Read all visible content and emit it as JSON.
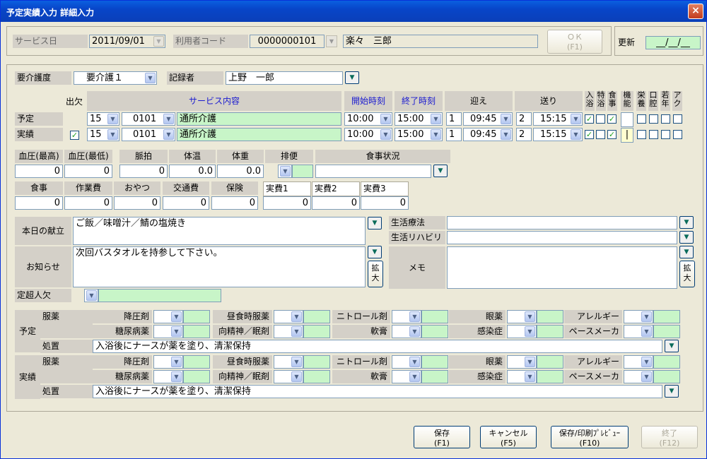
{
  "window": {
    "title": "予定実績入力 詳細入力",
    "close": "×"
  },
  "header": {
    "service_day_label": "サービス日",
    "service_day_value": "2011/09/01",
    "user_code_label": "利用者コード",
    "user_code_value": "0000000101",
    "user_name": "楽々　三郎",
    "ok_label": "ＯＫ",
    "ok_key": "(F1)",
    "update_label": "更新",
    "update_value": "__/__/__"
  },
  "care": {
    "level_label": "要介護度",
    "level_value": "要介護１",
    "recorder_label": "記録者",
    "recorder_value": "上野　一郎"
  },
  "grid": {
    "attend": "出欠",
    "content": "サービス内容",
    "start": "開始時刻",
    "end": "終了時刻",
    "pickup": "迎え",
    "dropoff": "送り",
    "chk_headers": [
      "入浴",
      "特浴",
      "食事",
      "機能",
      "栄養",
      "口腔",
      "若年",
      "アク"
    ],
    "rows": [
      {
        "label": "予定",
        "a": "15",
        "b": "0101",
        "name": "通所介護",
        "start": "10:00",
        "end": "15:00",
        "pn": "1",
        "pt": "09:45",
        "dn": "2",
        "dt": "15:15",
        "att": ""
      },
      {
        "label": "実績",
        "a": "15",
        "b": "0101",
        "name": "通所介護",
        "start": "10:00",
        "end": "15:00",
        "pn": "1",
        "pt": "09:45",
        "dn": "2",
        "dt": "15:15",
        "att": "✓"
      }
    ],
    "check": "✓",
    "func_mark": "|"
  },
  "vitals": {
    "bp_high": "血圧(最高)",
    "bp_low": "血圧(最低)",
    "pulse": "脈拍",
    "temp": "体温",
    "weight": "体重",
    "stool": "排便",
    "meal_status": "食事状況",
    "v_bp_high": "0",
    "v_bp_low": "0",
    "v_pulse": "0",
    "v_temp": "0.0",
    "v_weight": "0.0"
  },
  "fees": {
    "meal": "食事",
    "work": "作業費",
    "snack": "おやつ",
    "transport": "交通費",
    "insurance": "保険",
    "real1": "実費1",
    "real2": "実費2",
    "real3": "実費3",
    "v_meal": "0",
    "v_work": "0",
    "v_snack": "0",
    "v_transport": "0",
    "v_insurance": "0",
    "v_real1": "0",
    "v_real2": "0",
    "v_real3": "0"
  },
  "notes": {
    "menu_label": "本日の献立",
    "menu_value": "ご飯／味噌汁／鯖の塩焼き",
    "notice_label": "お知らせ",
    "notice_value": "次回バスタオルを持参して下さい。",
    "expand": "拡大",
    "over_label": "定超人欠",
    "therapy_label": "生活療法",
    "rehab_label": "生活リハビリ",
    "memo_label": "メモ"
  },
  "meds": {
    "plan_label": "予定",
    "actual_label": "実績",
    "med_label": "服薬",
    "treatment_label": "処置",
    "row1": [
      "降圧剤",
      "昼食時服薬",
      "ニトロール剤",
      "眼薬",
      "アレルギー"
    ],
    "row2": [
      "糖尿病薬",
      "向精神／眠剤",
      "軟膏",
      "感染症",
      "ペースメーカ"
    ],
    "plan_treatment": "入浴後にナースが薬を塗り、清潔保持",
    "actual_treatment": "入浴後にナースが薬を塗り、清潔保持"
  },
  "footer": {
    "save": "保存",
    "save_key": "(F1)",
    "cancel": "キャンセル",
    "cancel_key": "(F5)",
    "print": "保存/印刷ﾌﾟﾚﾋﾞｭｰ",
    "print_key": "(F10)",
    "close": "終了",
    "close_key": "(F12)"
  }
}
